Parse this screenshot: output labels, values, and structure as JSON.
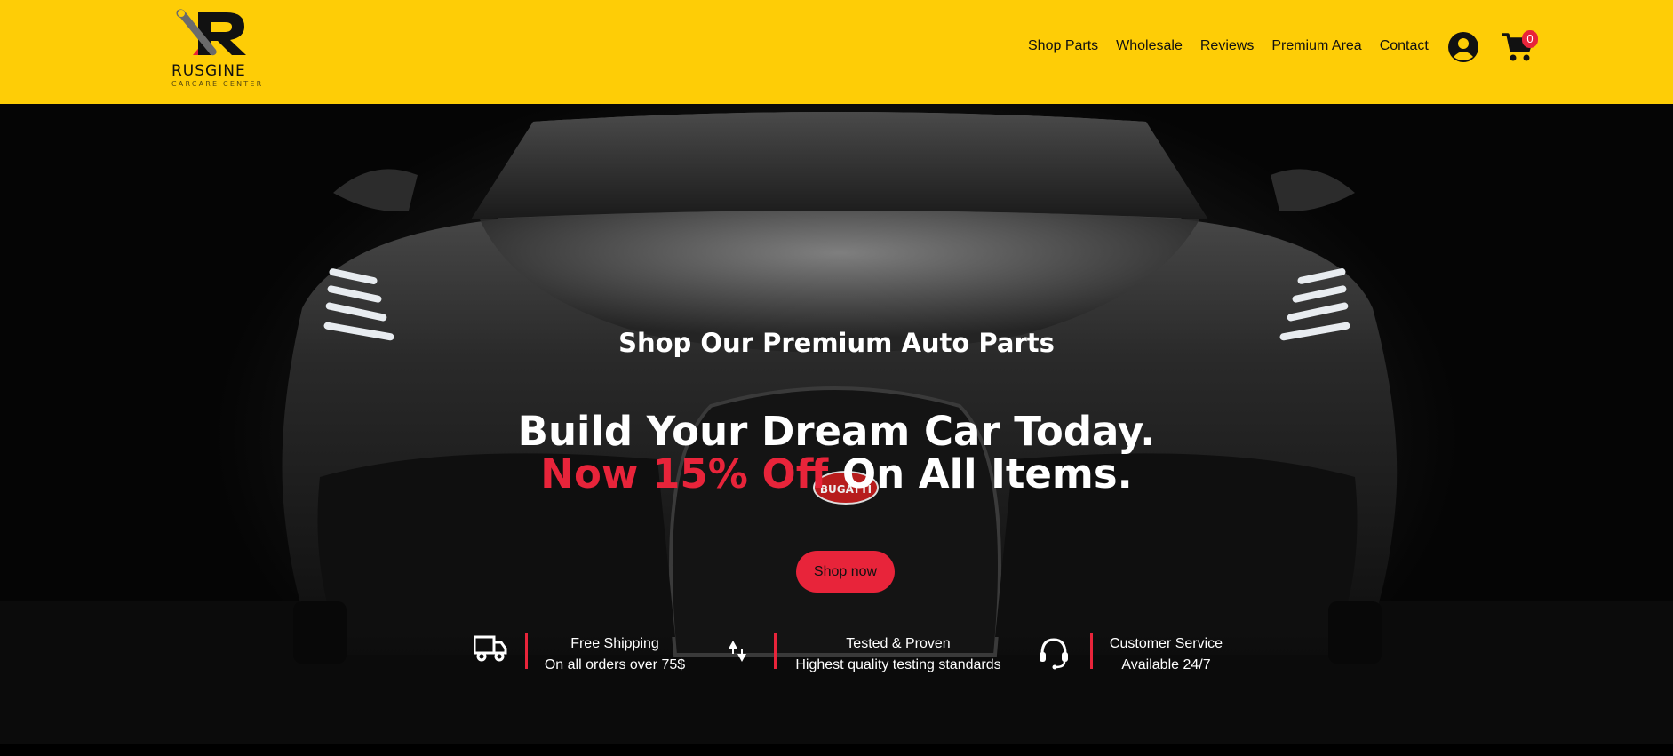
{
  "brand": {
    "name": "RUSGINE",
    "tagline": "CARCARE CENTER",
    "logo_icon": "wrench-r-logo-icon"
  },
  "nav": {
    "items": [
      {
        "label": "Shop Parts"
      },
      {
        "label": "Wholesale"
      },
      {
        "label": "Reviews"
      },
      {
        "label": "Premium Area"
      },
      {
        "label": "Contact"
      }
    ],
    "user_icon": "user-circle-icon",
    "cart_icon": "shopping-cart-icon",
    "cart_count": "0"
  },
  "hero": {
    "subtitle": "Shop Our Premium Auto Parts",
    "title_line1": "Build Your Dream Car Today.",
    "title_accent": "Now 15% Off",
    "title_line2_rest": " On All Items.",
    "button_label": "Shop now",
    "car_badge": "BUGATTI"
  },
  "features": [
    {
      "icon": "truck-icon",
      "title": "Free Shipping",
      "subtitle": "On all orders over 75$"
    },
    {
      "icon": "sort-arrows-icon",
      "title": "Tested & Proven",
      "subtitle": "Highest quality testing standards"
    },
    {
      "icon": "headset-icon",
      "title": "Customer Service",
      "subtitle": "Available 24/7"
    }
  ],
  "colors": {
    "header_bg": "#fecd06",
    "accent": "#e8243a",
    "hero_bg": "#0a0a0a",
    "text_light": "#ffffff"
  }
}
